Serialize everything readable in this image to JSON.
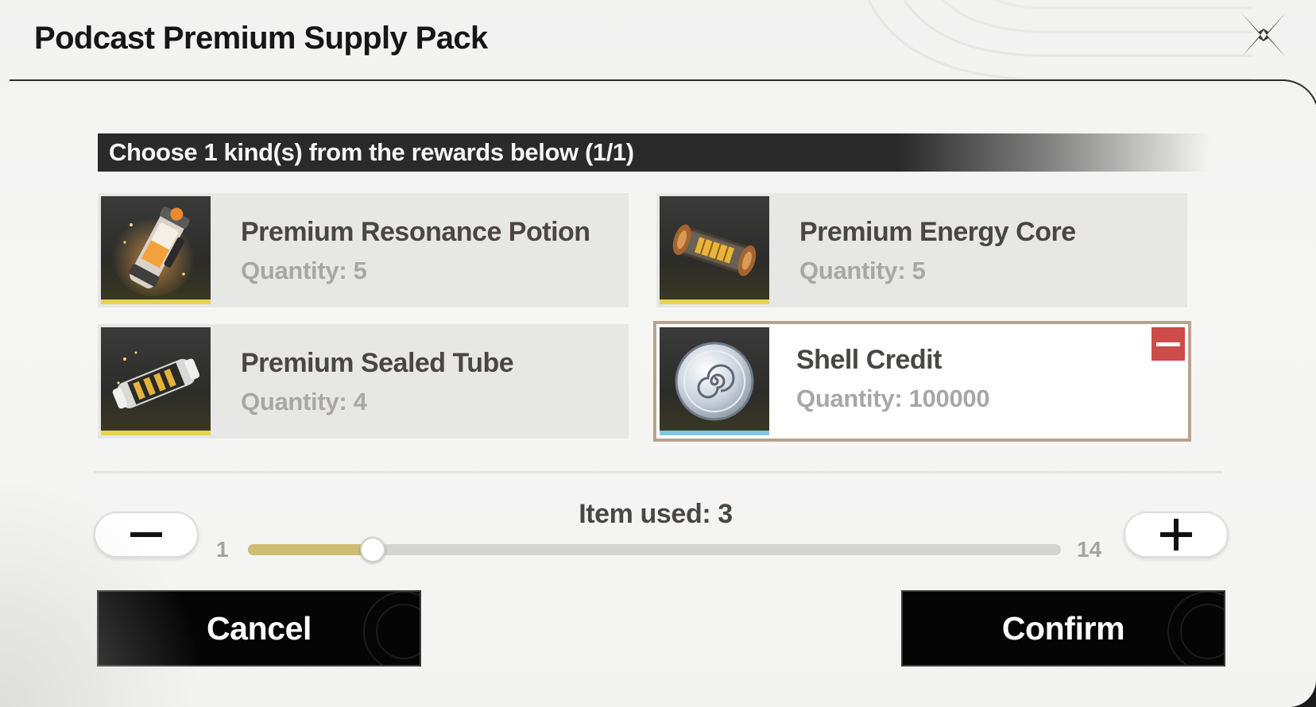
{
  "dialog": {
    "title": "Podcast Premium Supply Pack"
  },
  "prompt": {
    "text": "Choose 1 kind(s) from the rewards below (1/1)"
  },
  "rewards": [
    {
      "name": "Premium Resonance Potion",
      "quantity": "Quantity: 5",
      "icon": "resonance-potion-icon",
      "rarity_color": "#e6d34f",
      "selected": false
    },
    {
      "name": "Premium Energy Core",
      "quantity": "Quantity: 5",
      "icon": "energy-core-icon",
      "rarity_color": "#e6d34f",
      "selected": false
    },
    {
      "name": "Premium Sealed Tube",
      "quantity": "Quantity: 4",
      "icon": "sealed-tube-icon",
      "rarity_color": "#e6d34f",
      "selected": false
    },
    {
      "name": "Shell Credit",
      "quantity": "Quantity: 100000",
      "icon": "shell-credit-icon",
      "rarity_color": "#7fc6e0",
      "selected": true
    }
  ],
  "usage": {
    "label": "Item used: 3",
    "min": "1",
    "max": "14",
    "value": 3,
    "fill_color": "#cdbd72"
  },
  "actions": {
    "cancel_label": "Cancel",
    "confirm_label": "Confirm"
  },
  "colors": {
    "selected_border": "#b9a38d",
    "deselect": "#cc4b4b",
    "button_bg": "#050505"
  }
}
